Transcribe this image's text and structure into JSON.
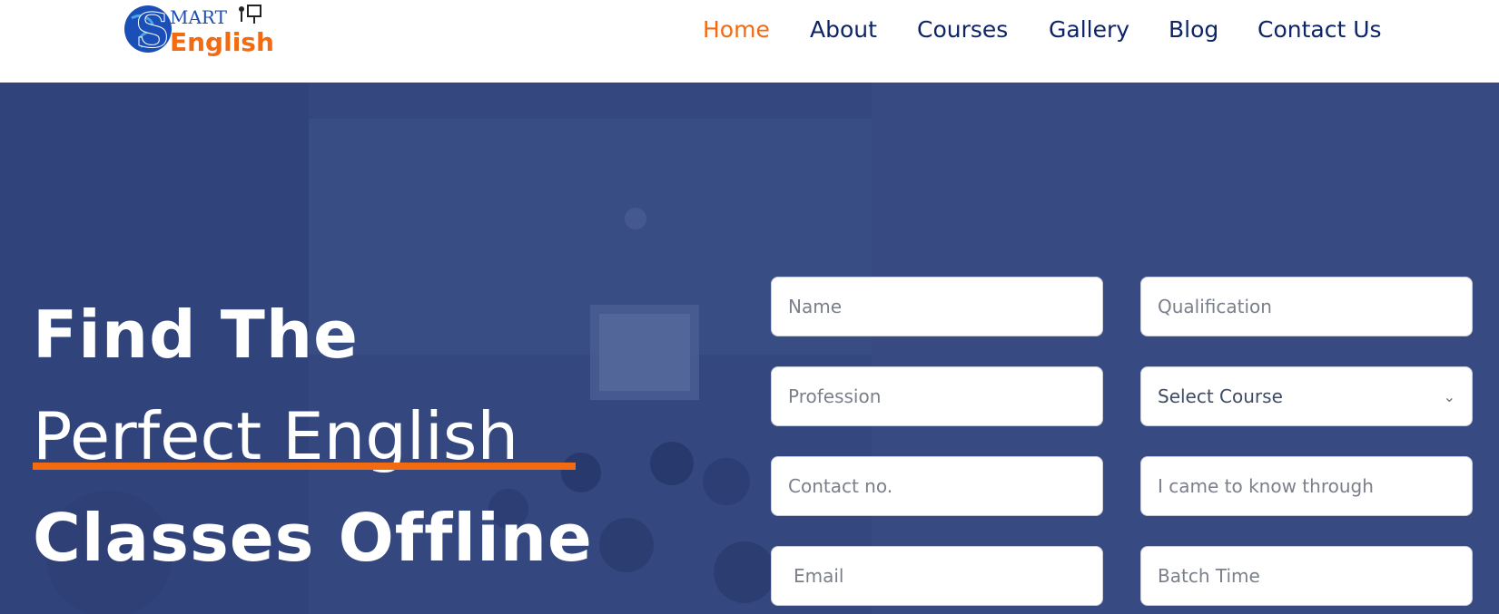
{
  "brand": {
    "logo_name": "Smart English",
    "logo_text_smart": "MART",
    "logo_text_english": "English",
    "logo_letter": "S"
  },
  "nav": {
    "items": [
      {
        "label": "Home",
        "active": true
      },
      {
        "label": "About"
      },
      {
        "label": "Courses"
      },
      {
        "label": "Gallery"
      },
      {
        "label": "Blog"
      },
      {
        "label": "Contact Us"
      }
    ]
  },
  "hero": {
    "line1": "Find The",
    "line2": "Perfect English",
    "line3": "Classes Offline"
  },
  "form": {
    "name_placeholder": "Name",
    "qualification_placeholder": "Qualification",
    "profession_placeholder": "Profession",
    "course_selected": "Select Course",
    "contact_placeholder": "Contact no.",
    "source_placeholder": "I came to know through",
    "email_placeholder": "Email",
    "batch_placeholder": "Batch Time"
  },
  "colors": {
    "accent": "#f26a12",
    "navy": "#0d2467",
    "hero_overlay": "#33477f"
  }
}
